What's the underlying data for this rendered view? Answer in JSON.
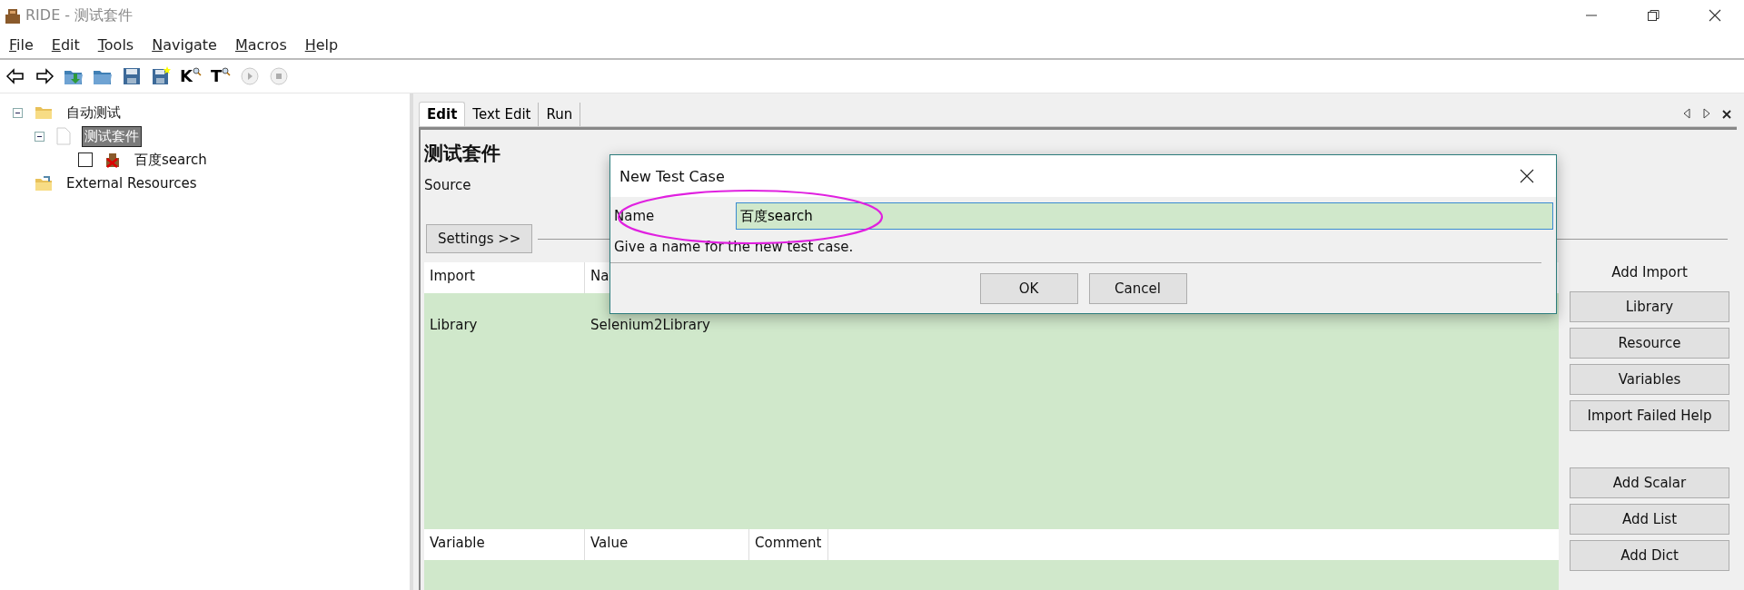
{
  "window": {
    "title": "RIDE - 测试套件"
  },
  "menu": [
    "File",
    "Edit",
    "Tools",
    "Navigate",
    "Macros",
    "Help"
  ],
  "toolbar": [
    {
      "kind": "back"
    },
    {
      "kind": "forward"
    },
    {
      "kind": "open"
    },
    {
      "kind": "folder"
    },
    {
      "kind": "save"
    },
    {
      "kind": "saveall"
    },
    {
      "kind": "search",
      "label": "K"
    },
    {
      "kind": "search",
      "label": "T"
    },
    {
      "kind": "run",
      "disabled": true
    },
    {
      "kind": "stop",
      "disabled": true
    }
  ],
  "tree": [
    {
      "label": "自动测试",
      "kind": "folder",
      "expanded": true,
      "selected": false,
      "children": [
        {
          "label": "测试套件",
          "kind": "file",
          "expanded": true,
          "selected": true,
          "children": [
            {
              "label": "百度search",
              "kind": "test",
              "checked": false,
              "selected": false
            }
          ]
        }
      ]
    },
    {
      "label": "External Resources",
      "kind": "resources",
      "selected": false
    }
  ],
  "editor": {
    "tabs": [
      {
        "label": "Edit",
        "selected": true
      },
      {
        "label": "Text Edit",
        "selected": false
      },
      {
        "label": "Run",
        "selected": false
      }
    ],
    "title": "测试套件",
    "source_label": "Source",
    "settings_button": "Settings >>",
    "imports": {
      "columns": [
        "Import",
        "Na"
      ],
      "rows": [
        [
          "Library",
          "Selenium2Library"
        ]
      ]
    },
    "import_actions": {
      "title": "Add Import",
      "buttons": [
        "Library",
        "Resource",
        "Variables",
        "Import Failed Help"
      ]
    },
    "variables": {
      "columns": [
        "Variable",
        "Value",
        "Comment"
      ]
    },
    "variable_actions": [
      "Add Scalar",
      "Add List",
      "Add Dict"
    ]
  },
  "dialog": {
    "title": "New Test Case",
    "field_label": "Name",
    "value": "百度search",
    "hint": "Give a name for the new test case.",
    "buttons": [
      "OK",
      "Cancel"
    ]
  }
}
